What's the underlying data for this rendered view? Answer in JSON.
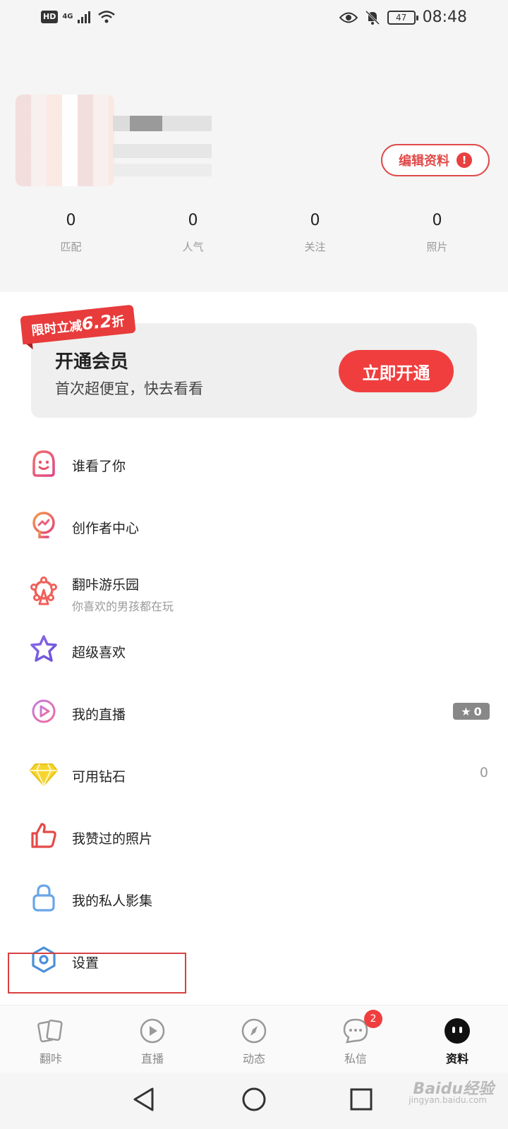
{
  "status_bar": {
    "hd": "HD",
    "network": "4G",
    "battery": "47",
    "time": "08:48"
  },
  "profile": {
    "edit_label": "编辑资料",
    "warn": "!",
    "stats": [
      {
        "value": "0",
        "label": "匹配"
      },
      {
        "value": "0",
        "label": "人气"
      },
      {
        "value": "0",
        "label": "关注"
      },
      {
        "value": "0",
        "label": "照片"
      }
    ]
  },
  "vip": {
    "tag_prefix": "限时立减",
    "tag_value": "6.2",
    "tag_suffix": "折",
    "title": "开通会员",
    "subtitle": "首次超便宜，快去看看",
    "button": "立即开通"
  },
  "menu": [
    {
      "label": "谁看了你",
      "icon": "face-icon"
    },
    {
      "label": "创作者中心",
      "icon": "creator-icon"
    },
    {
      "label": "翻咔游乐园",
      "sub": "你喜欢的男孩都在玩",
      "icon": "ferris-wheel-icon"
    },
    {
      "label": "超级喜欢",
      "icon": "star-icon"
    },
    {
      "label": "我的直播",
      "icon": "live-play-icon",
      "badge": "0"
    },
    {
      "label": "可用钻石",
      "icon": "diamond-icon",
      "count": "0"
    },
    {
      "label": "我赞过的照片",
      "icon": "thumbs-up-icon"
    },
    {
      "label": "我的私人影集",
      "icon": "lock-icon"
    },
    {
      "label": "设置",
      "icon": "settings-icon"
    }
  ],
  "bottom_nav": [
    {
      "label": "翻咔",
      "icon": "cards-icon"
    },
    {
      "label": "直播",
      "icon": "play-icon"
    },
    {
      "label": "动态",
      "icon": "compass-icon"
    },
    {
      "label": "私信",
      "icon": "chat-icon",
      "badge": "2"
    },
    {
      "label": "资料",
      "icon": "profile-face-icon",
      "active": true
    }
  ],
  "watermark": {
    "text": "Baidu经验",
    "sub": "jingyan.baidu.com"
  },
  "colors": {
    "accent": "#f03e3e",
    "edit_border": "#e04a4a"
  }
}
